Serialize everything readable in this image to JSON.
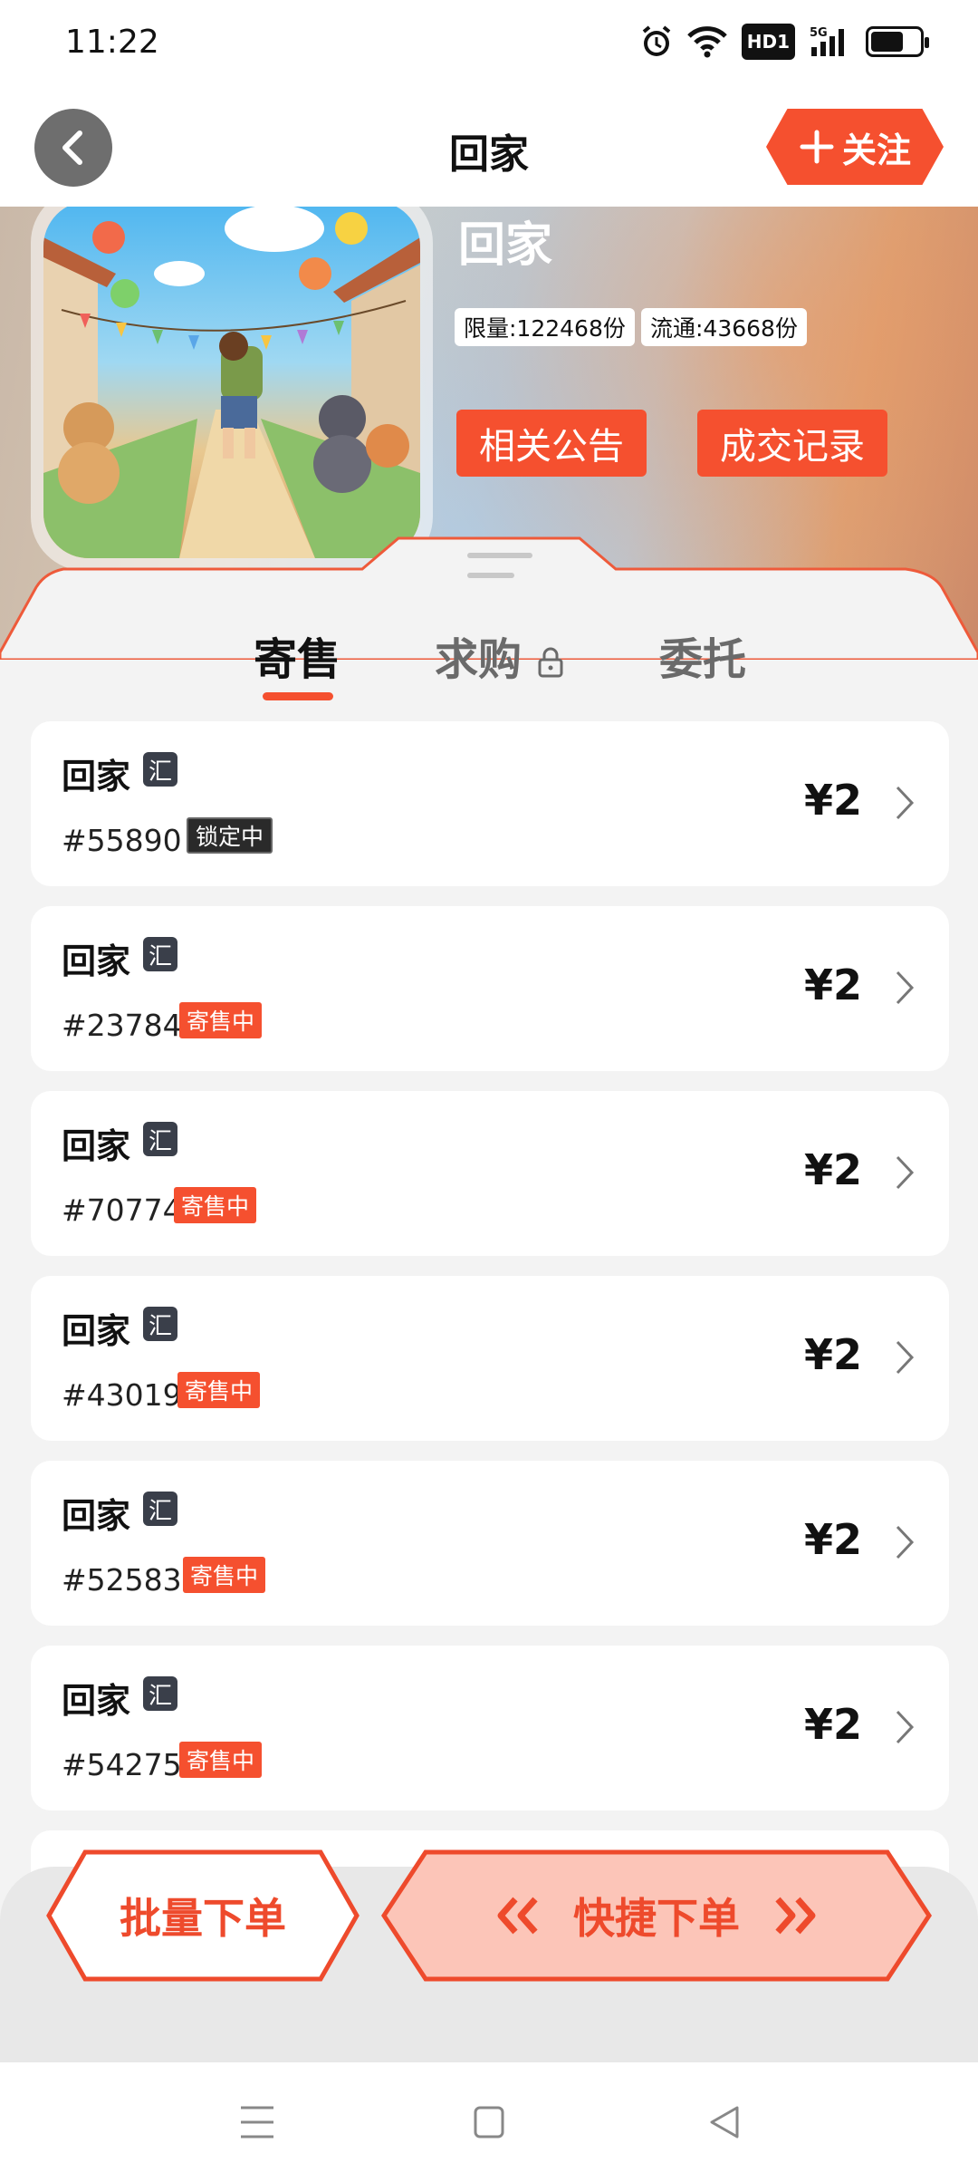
{
  "status_bar": {
    "time": "11:22",
    "hd": "HD1",
    "network": "5G"
  },
  "header": {
    "title": "回家",
    "follow_label": "关注"
  },
  "collection": {
    "name": "回家",
    "limit_label": "限量:122468份",
    "circulation_label": "流通:43668份",
    "announcement_button": "相关公告",
    "records_button": "成交记录"
  },
  "tabs": [
    {
      "label": "寄售",
      "active": true
    },
    {
      "label": "求购",
      "locked": true
    },
    {
      "label": "委托"
    }
  ],
  "listings": [
    {
      "name": "回家",
      "badge": "汇",
      "serial": "#55890",
      "status": "锁定中",
      "status_type": "locked",
      "price": "¥2"
    },
    {
      "name": "回家",
      "badge": "汇",
      "serial": "#23784",
      "status": "寄售中",
      "status_type": "sale",
      "price": "¥2"
    },
    {
      "name": "回家",
      "badge": "汇",
      "serial": "#70774",
      "status": "寄售中",
      "status_type": "sale",
      "price": "¥2"
    },
    {
      "name": "回家",
      "badge": "汇",
      "serial": "#43019",
      "status": "寄售中",
      "status_type": "sale",
      "price": "¥2"
    },
    {
      "name": "回家",
      "badge": "汇",
      "serial": "#52583",
      "status": "寄售中",
      "status_type": "sale",
      "price": "¥2"
    },
    {
      "name": "回家",
      "badge": "汇",
      "serial": "#54275",
      "status": "寄售中",
      "status_type": "sale",
      "price": "¥2"
    }
  ],
  "actions": {
    "batch_order": "批量下单",
    "quick_order": "快捷下单"
  },
  "colors": {
    "accent": "#f5502f",
    "quick_fill": "#fcc5b8",
    "badge_dark": "#3a3f4a"
  }
}
